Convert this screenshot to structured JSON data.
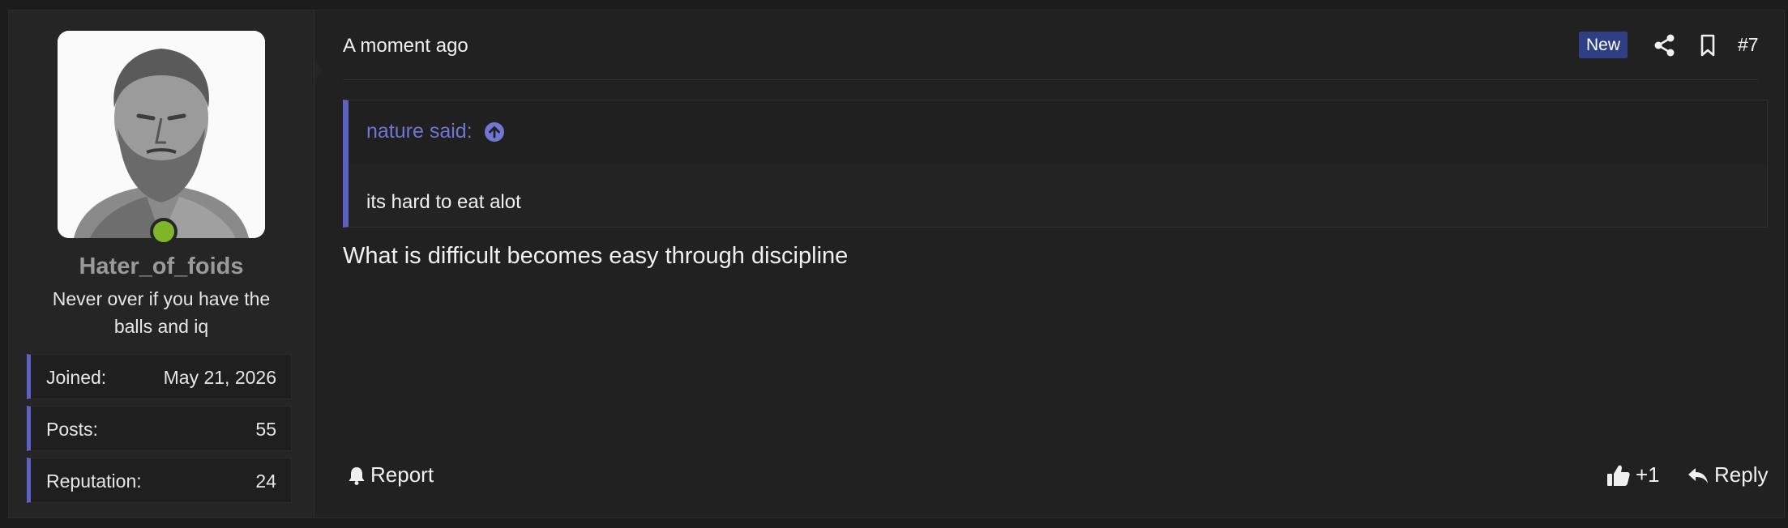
{
  "user": {
    "username": "Hater_of_foids",
    "title": "Never over if you have the balls and iq",
    "online": true,
    "stats": [
      {
        "label": "Joined:",
        "value": "May 21, 2026"
      },
      {
        "label": "Posts:",
        "value": "55"
      },
      {
        "label": "Reputation:",
        "value": "24"
      }
    ]
  },
  "post": {
    "time": "A moment ago",
    "badge": "New",
    "number": "#7",
    "quote": {
      "attribution": "nature said:",
      "text": "its hard to eat alot"
    },
    "message": "What is difficult becomes easy through discipline"
  },
  "actions": {
    "report": "Report",
    "like_count": "+1",
    "reply": "Reply"
  },
  "colors": {
    "accent": "#5c62c4",
    "quote_link": "#6f76d3",
    "badge_bg": "#2f3f84",
    "online": "#7fb528",
    "username": "#9a9a9a"
  },
  "icons": [
    "share-icon",
    "bookmark-icon",
    "up-arrow-circle-icon",
    "bell-icon",
    "thumbs-up-icon",
    "reply-icon"
  ]
}
